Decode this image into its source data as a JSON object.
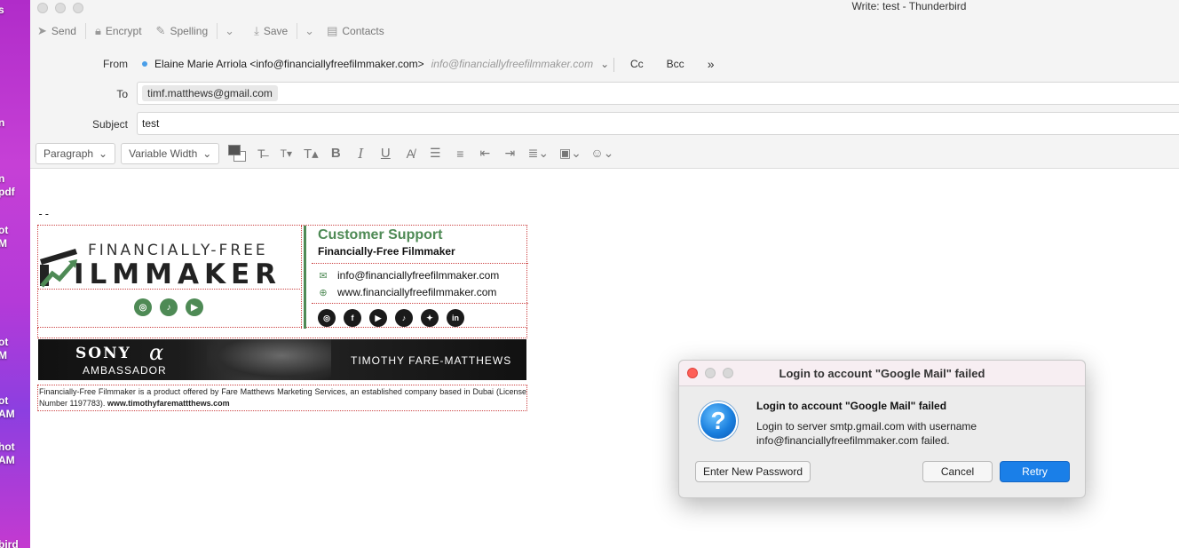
{
  "desktop": {
    "labels": [
      "s",
      "n",
      "n\npdf",
      "ot\nM",
      "ot\nM",
      "ot\nAM",
      "hot\nAM",
      "bird"
    ]
  },
  "window": {
    "title": "Write: test - Thunderbird"
  },
  "toolbar": {
    "send": "Send",
    "encrypt": "Encrypt",
    "spelling": "Spelling",
    "save": "Save",
    "contacts": "Contacts"
  },
  "header": {
    "from_label": "From",
    "from_value": "Elaine Marie Arriola <info@financiallyfreefilmmaker.com>",
    "from_identity": "info@financiallyfreefilmmaker.com",
    "cc": "Cc",
    "bcc": "Bcc",
    "more": "»",
    "to_label": "To",
    "to_recipient": "timf.matthews@gmail.com",
    "subject_label": "Subject",
    "subject_value": "test"
  },
  "format": {
    "paragraph": "Paragraph",
    "font": "Variable Width"
  },
  "signature": {
    "dashes": "--",
    "logo_top": "FINANCIALLY-FREE",
    "logo_main": "ILMMAKER",
    "title": "Customer Support",
    "company": "Financially-Free Filmmaker",
    "email": "info@financiallyfreefilmmaker.com",
    "website": "www.financiallyfreefilmmaker.com",
    "banner_sony": "SONY",
    "banner_alpha": "α",
    "banner_ambassador": "AMBASSADOR",
    "banner_name": "TIMOTHY FARE-MATTHEWS",
    "disclaimer": "Financially-Free Filmmaker is a product offered by Fare Matthews Marketing Services, an established company based in Dubai (License Number 1197783).",
    "disclaimer_link": "www.timothyfaremattthews.com"
  },
  "dialog": {
    "title": "Login to account \"Google Mail\" failed",
    "heading": "Login to account \"Google Mail\" failed",
    "message": "Login to server smtp.gmail.com with username info@financiallyfreefilmmaker.com failed.",
    "btn_new_password": "Enter New Password",
    "btn_cancel": "Cancel",
    "btn_retry": "Retry"
  },
  "colors": {
    "brand_green": "#4e8a55",
    "accent_blue": "#1a7fe8"
  }
}
